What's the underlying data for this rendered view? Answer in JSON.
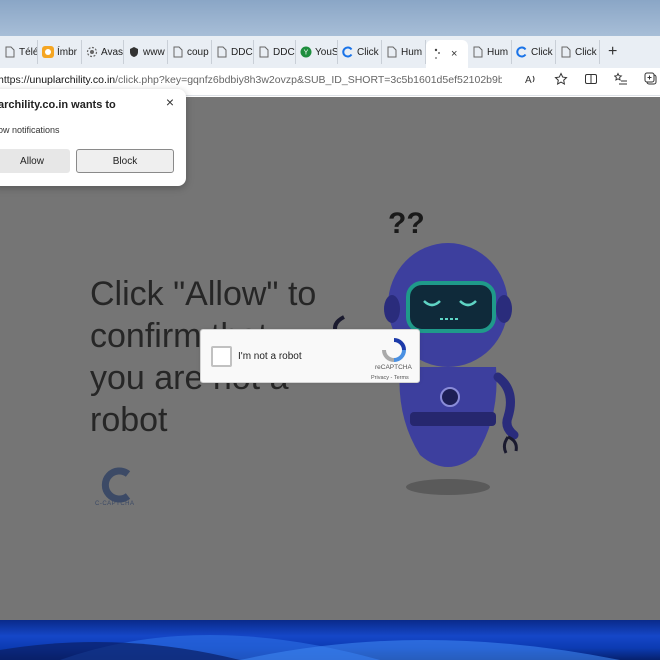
{
  "tabs": [
    {
      "label": "Télé",
      "icon": "page-icon",
      "color": "#888888"
    },
    {
      "label": "Ímbr",
      "icon": "orange-favicon",
      "color": "#f5a623"
    },
    {
      "label": "Avas",
      "icon": "gear-favicon",
      "color": "#666666"
    },
    {
      "label": "www",
      "icon": "shield-favicon",
      "color": "#333333"
    },
    {
      "label": "coup",
      "icon": "page-icon",
      "color": "#888888"
    },
    {
      "label": "DDC",
      "icon": "page-icon",
      "color": "#888888"
    },
    {
      "label": "DDC",
      "icon": "page-icon",
      "color": "#888888"
    },
    {
      "label": "YouS",
      "icon": "green-circle-favicon",
      "color": "#1e8e3e"
    },
    {
      "label": "Click",
      "icon": "blue-c-favicon",
      "color": "#1a73e8"
    },
    {
      "label": "Hum",
      "icon": "page-icon",
      "color": "#888888"
    }
  ],
  "active_tab": {
    "icon": "loading-icon",
    "close": "×"
  },
  "tabs_after": [
    {
      "label": "Hum",
      "icon": "page-icon",
      "color": "#888888"
    },
    {
      "label": "Click",
      "icon": "blue-c-favicon",
      "color": "#1a73e8"
    },
    {
      "label": "Click",
      "icon": "page-icon",
      "color": "#888888"
    }
  ],
  "new_tab": "+",
  "address": {
    "scheme": "https://",
    "host": "unuplarchility.co.in",
    "path": "/click.php?key=gqnfz6bdbiy8h3w2ovzp&SUB_ID_SHORT=3c5b1601d5ef52102b9be..."
  },
  "notification": {
    "title": "archility.co.in wants to",
    "description": "ow notifications",
    "allow": "Allow",
    "block": "Block",
    "close": "×"
  },
  "page": {
    "headline_lines": [
      "Click \"Allow\" to",
      "confirm that",
      "you are not a",
      "robot"
    ],
    "captcha_logo_text": "C-CAPTCHA"
  },
  "recaptcha": {
    "label": "I'm not a robot",
    "brand": "reCAPTCHA",
    "links": "Privacy - Terms"
  },
  "colors": {
    "page_bg": "#757575",
    "robot_body": "#3d3f9e",
    "robot_visor": "#1f9a8a",
    "taskbar": "#1547c8"
  }
}
